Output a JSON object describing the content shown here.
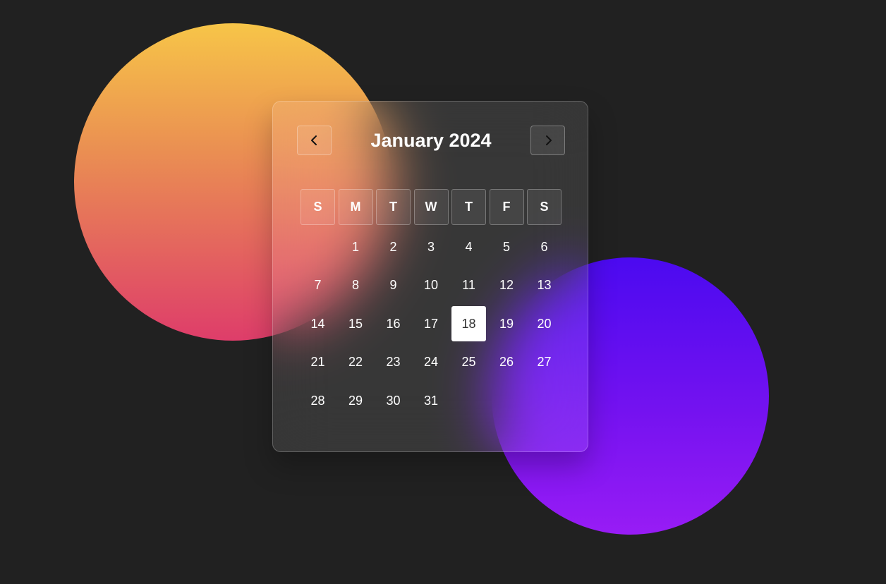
{
  "calendar": {
    "title": "January 2024",
    "prev_icon": "chevron-left-icon",
    "next_icon": "chevron-right-icon",
    "weekdays": [
      "S",
      "M",
      "T",
      "W",
      "T",
      "F",
      "S"
    ],
    "first_weekday_index": 1,
    "days_in_month": 31,
    "selected_day": 18
  },
  "colors": {
    "background": "#212121",
    "warm_orb_top": "#f7c548",
    "warm_orb_bottom": "#de3d6a",
    "violet_orb_top": "#4b0af0",
    "violet_orb_bottom": "#981cf5",
    "selected_day_bg": "#ffffff"
  }
}
